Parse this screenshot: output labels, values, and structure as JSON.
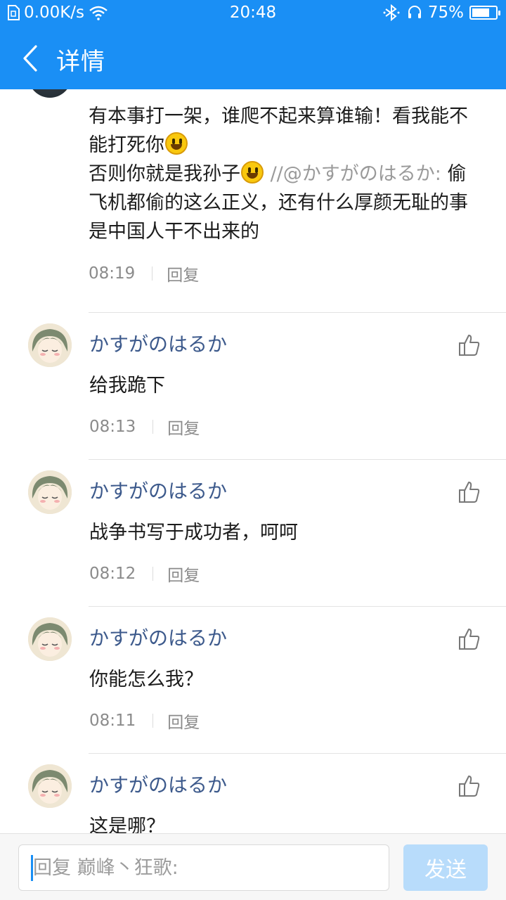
{
  "status_bar": {
    "net_speed": "0.00K/s",
    "time": "20:48",
    "battery_text": "75%",
    "battery_level": 0.75,
    "icons": [
      "sim-icon",
      "wifi-icon",
      "bluetooth-icon",
      "headset-icon",
      "battery-icon"
    ]
  },
  "header": {
    "title": "详情",
    "back_icon": "chevron-left-icon"
  },
  "first_comment": {
    "line1": "有本事打一架，谁爬不起来算谁输！看我能不能打死你",
    "line2_before": "否则你就是我孙子",
    "line2_quote": " //@かすがのはるか: ",
    "line2_after": "偷飞机都偷的这么正义，还有什么厚颜无耻的事是中国人干不出来的",
    "time": "08:19",
    "reply_label": "回复"
  },
  "replies": [
    {
      "user": "かすがのはるか",
      "text": "给我跪下",
      "time": "08:13",
      "reply_label": "回复"
    },
    {
      "user": "かすがのはるか",
      "text": "战争书写于成功者，呵呵",
      "time": "08:12",
      "reply_label": "回复"
    },
    {
      "user": "かすがのはるか",
      "text": "你能怎么我？",
      "time": "08:11",
      "reply_label": "回复"
    },
    {
      "user": "かすがのはるか",
      "text": "这是哪？",
      "time": "",
      "reply_label": ""
    }
  ],
  "input_bar": {
    "placeholder": "回复 巅峰丶狂歌:",
    "send_label": "发送"
  },
  "colors": {
    "accent": "#1a8ff5",
    "username": "#3d5a8c",
    "send_disabled": "#b8dcfb"
  }
}
